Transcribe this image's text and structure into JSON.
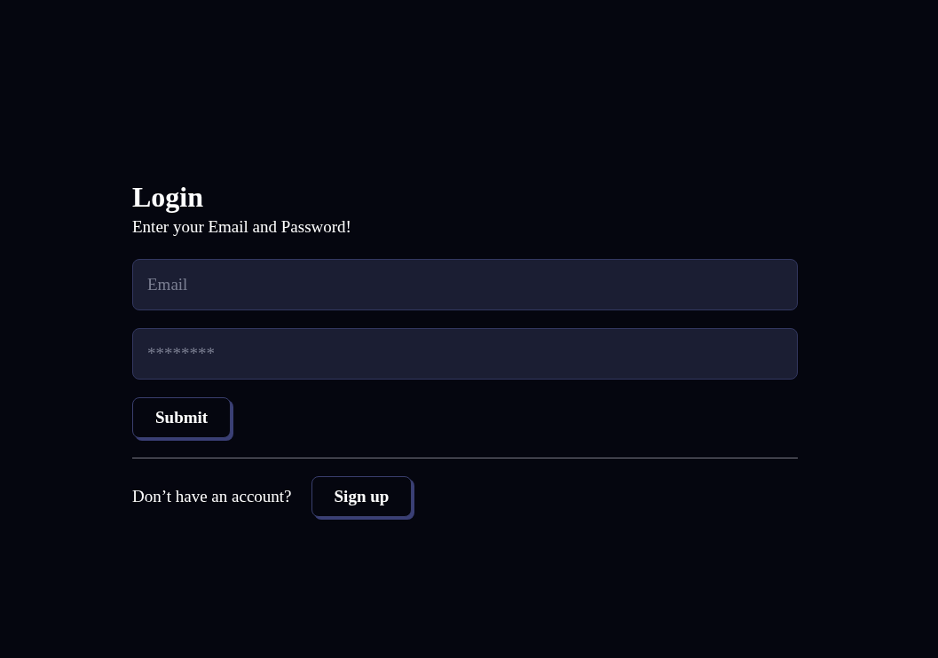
{
  "form": {
    "title": "Login",
    "subtitle": "Enter your Email and Password!",
    "fields": [
      {
        "placeholder": "Email"
      },
      {
        "placeholder": "********"
      }
    ],
    "submit": "Submit",
    "signup_prompt": "Don’t have an account?",
    "signup_button": "Sign up"
  }
}
